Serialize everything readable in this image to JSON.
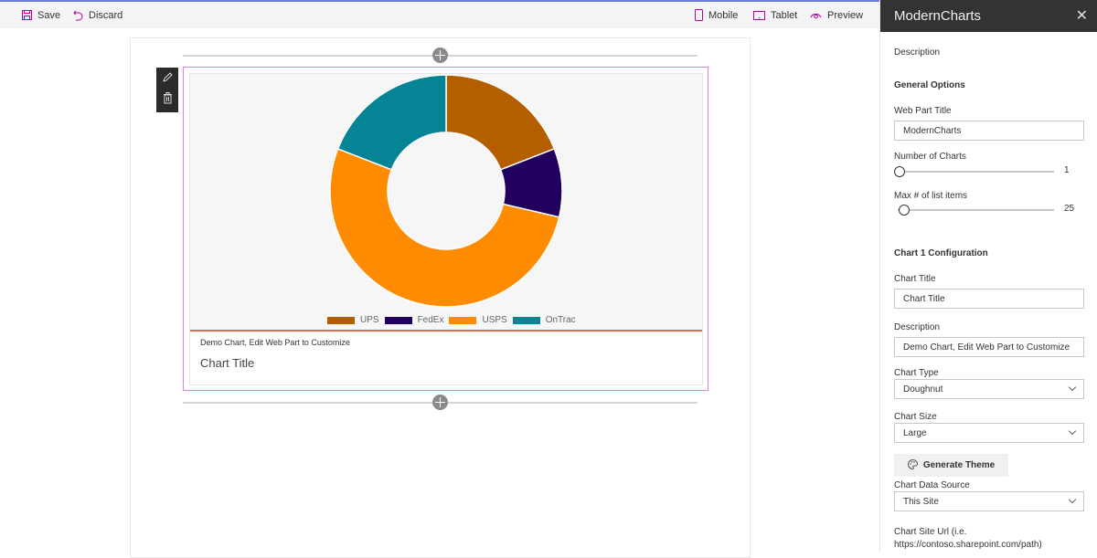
{
  "command_bar": {
    "save_label": "Save",
    "discard_label": "Discard",
    "mobile_label": "Mobile",
    "tablet_label": "Tablet",
    "preview_label": "Preview",
    "icon_color": "#b4009e"
  },
  "webpart": {
    "description": "Demo Chart, Edit Web Part to Customize",
    "title": "Chart Title",
    "accent_color": "#e06a5a"
  },
  "chart_data": {
    "type": "pie",
    "subtype": "doughnut",
    "title": "Chart Title",
    "categories": [
      "UPS",
      "FedEx",
      "USPS",
      "OnTrac"
    ],
    "values": [
      19,
      9.5,
      52,
      19
    ],
    "colors": [
      "#b35f00",
      "#220060",
      "#ff8c00",
      "#048494"
    ],
    "legend_position": "bottom"
  },
  "panel": {
    "title": "ModernCharts",
    "description_label": "Description",
    "general_options_heading": "General Options",
    "web_part_title_label": "Web Part Title",
    "web_part_title_value": "ModernCharts",
    "number_of_charts_label": "Number of Charts",
    "number_of_charts_value": "1",
    "max_list_items_label": "Max # of list items",
    "max_list_items_value": "25",
    "chart1_heading": "Chart 1 Configuration",
    "chart_title_label": "Chart Title",
    "chart_title_value": "Chart Title",
    "chart_description_label": "Description",
    "chart_description_value": "Demo Chart, Edit Web Part to Customize",
    "chart_type_label": "Chart Type",
    "chart_type_value": "Doughnut",
    "chart_size_label": "Chart Size",
    "chart_size_value": "Large",
    "generate_theme_label": "Generate Theme",
    "data_source_label": "Chart Data Source",
    "data_source_value": "This Site",
    "site_url_label_line1": "Chart Site Url (i.e.",
    "site_url_label_line2": "https://contoso.sharepoint.com/path)"
  }
}
